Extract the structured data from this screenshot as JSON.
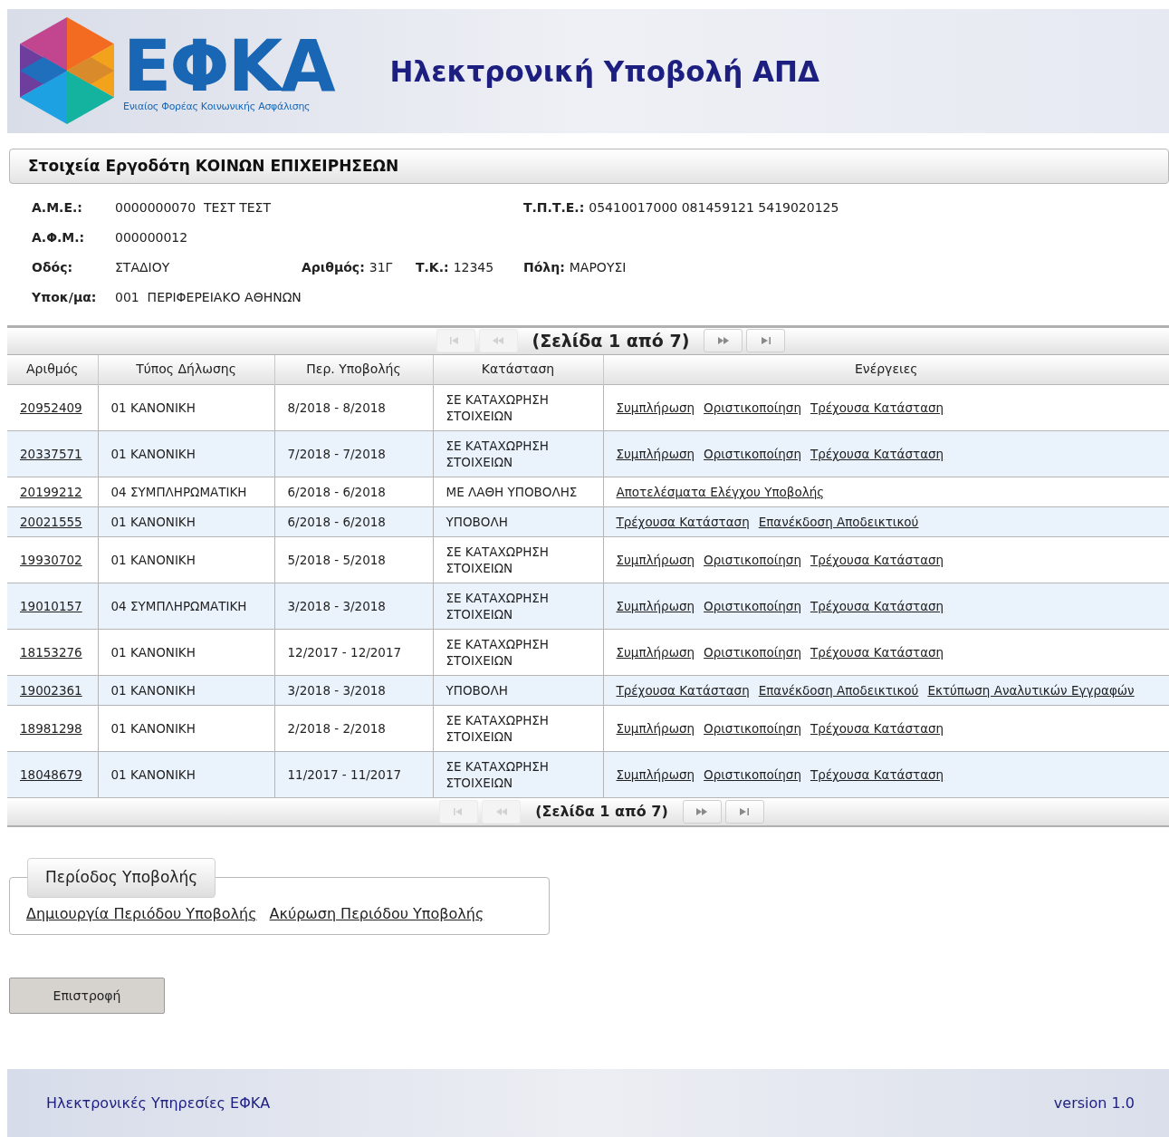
{
  "header": {
    "logo_title": "ΕΦΚΑ",
    "logo_subtitle": "Ενιαίος Φορέας Κοινωνικής Ασφάλισης",
    "title": "Ηλεκτρονική Υποβολή ΑΠΔ"
  },
  "employer": {
    "title": "Στοιχεία Εργοδότη ΚΟΙΝΩΝ ΕΠΙΧΕΙΡΗΣΕΩΝ",
    "rows": [
      {
        "fields": [
          {
            "label": "Α.Μ.Ε.:",
            "value": "0000000070  ΤΕΣΤ ΤΕΣΤ"
          },
          {
            "label": "Τ.Π.Τ.Ε.:",
            "value": "05410017000 081459121 5419020125"
          }
        ]
      },
      {
        "fields": [
          {
            "label": "Α.Φ.Μ.:",
            "value": "000000012"
          }
        ]
      },
      {
        "fields": [
          {
            "label": "Οδός:",
            "value": "ΣΤΑΔΙΟΥ"
          },
          {
            "label": "Αριθμός:",
            "value": "31Γ"
          },
          {
            "label": "Τ.Κ.:",
            "value": "12345"
          },
          {
            "label": "Πόλη:",
            "value": "ΜΑΡΟΥΣΙ"
          }
        ]
      },
      {
        "fields": [
          {
            "label": "Υποκ/μα:",
            "value": "001  ΠΕΡΙΦΕΡΕΙΑΚΟ ΑΘΗΝΩΝ"
          }
        ]
      }
    ]
  },
  "pager_top": {
    "text": "(Σελίδα 1 από 7)",
    "buttons": [
      {
        "kind": "first",
        "disabled": true
      },
      {
        "kind": "prev",
        "disabled": true
      },
      {
        "kind": "next",
        "disabled": false
      },
      {
        "kind": "last",
        "disabled": false
      }
    ]
  },
  "table": {
    "columns": [
      "Αριθμός",
      "Τύπος Δήλωσης",
      "Περ. Υποβολής",
      "Κατάσταση",
      "Ενέργειες"
    ],
    "rows": [
      {
        "number": "20952409",
        "type": "01 ΚΑΝΟΝΙΚΗ",
        "period": "8/2018 - 8/2018",
        "status": "ΣΕ ΚΑΤΑΧΩΡΗΣΗ ΣΤΟΙΧΕΙΩΝ",
        "actions": [
          "Συμπλήρωση",
          "Οριστικοποίηση",
          "Τρέχουσα Κατάσταση"
        ]
      },
      {
        "number": "20337571",
        "type": "01 ΚΑΝΟΝΙΚΗ",
        "period": "7/2018 - 7/2018",
        "status": "ΣΕ ΚΑΤΑΧΩΡΗΣΗ ΣΤΟΙΧΕΙΩΝ",
        "actions": [
          "Συμπλήρωση",
          "Οριστικοποίηση",
          "Τρέχουσα Κατάσταση"
        ]
      },
      {
        "number": "20199212",
        "type": "04 ΣΥΜΠΛΗΡΩΜΑΤΙΚΗ",
        "period": "6/2018 - 6/2018",
        "status": "ΜΕ ΛΑΘΗ ΥΠΟΒΟΛΗΣ",
        "actions": [
          "Αποτελέσματα Ελέγχου Υποβολής"
        ]
      },
      {
        "number": "20021555",
        "type": "01 ΚΑΝΟΝΙΚΗ",
        "period": "6/2018 - 6/2018",
        "status": "ΥΠΟΒΟΛΗ",
        "actions": [
          "Τρέχουσα Κατάσταση",
          "Επανέκδοση Αποδεικτικού"
        ]
      },
      {
        "number": "19930702",
        "type": "01 ΚΑΝΟΝΙΚΗ",
        "period": "5/2018 - 5/2018",
        "status": "ΣΕ ΚΑΤΑΧΩΡΗΣΗ ΣΤΟΙΧΕΙΩΝ",
        "actions": [
          "Συμπλήρωση",
          "Οριστικοποίηση",
          "Τρέχουσα Κατάσταση"
        ]
      },
      {
        "number": "19010157",
        "type": "04 ΣΥΜΠΛΗΡΩΜΑΤΙΚΗ",
        "period": "3/2018 - 3/2018",
        "status": "ΣΕ ΚΑΤΑΧΩΡΗΣΗ ΣΤΟΙΧΕΙΩΝ",
        "actions": [
          "Συμπλήρωση",
          "Οριστικοποίηση",
          "Τρέχουσα Κατάσταση"
        ]
      },
      {
        "number": "18153276",
        "type": "01 ΚΑΝΟΝΙΚΗ",
        "period": "12/2017 - 12/2017",
        "status": "ΣΕ ΚΑΤΑΧΩΡΗΣΗ ΣΤΟΙΧΕΙΩΝ",
        "actions": [
          "Συμπλήρωση",
          "Οριστικοποίηση",
          "Τρέχουσα Κατάσταση"
        ]
      },
      {
        "number": "19002361",
        "type": "01 ΚΑΝΟΝΙΚΗ",
        "period": "3/2018 - 3/2018",
        "status": "ΥΠΟΒΟΛΗ",
        "actions": [
          "Τρέχουσα Κατάσταση",
          "Επανέκδοση Αποδεικτικού",
          "Εκτύπωση Αναλυτικών Εγγραφών"
        ]
      },
      {
        "number": "18981298",
        "type": "01 ΚΑΝΟΝΙΚΗ",
        "period": "2/2018 - 2/2018",
        "status": "ΣΕ ΚΑΤΑΧΩΡΗΣΗ ΣΤΟΙΧΕΙΩΝ",
        "actions": [
          "Συμπλήρωση",
          "Οριστικοποίηση",
          "Τρέχουσα Κατάσταση"
        ]
      },
      {
        "number": "18048679",
        "type": "01 ΚΑΝΟΝΙΚΗ",
        "period": "11/2017 - 11/2017",
        "status": "ΣΕ ΚΑΤΑΧΩΡΗΣΗ ΣΤΟΙΧΕΙΩΝ",
        "actions": [
          "Συμπλήρωση",
          "Οριστικοποίηση",
          "Τρέχουσα Κατάσταση"
        ]
      }
    ]
  },
  "pager_bottom": {
    "text": "(Σελίδα 1 από 7)",
    "buttons": [
      {
        "kind": "first",
        "disabled": true
      },
      {
        "kind": "prev",
        "disabled": true
      },
      {
        "kind": "next",
        "disabled": false
      },
      {
        "kind": "last",
        "disabled": false
      }
    ]
  },
  "period_panel": {
    "legend": "Περίοδος Υποβολής",
    "links": [
      "Δημιουργία Περιόδου Υποβολής",
      "Ακύρωση Περιόδου Υποβολής"
    ]
  },
  "back_button": "Επιστροφή",
  "footer": {
    "left": "Ηλεκτρονικές Υπηρεσίες ΕΦΚΑ",
    "right": "version 1.0"
  }
}
